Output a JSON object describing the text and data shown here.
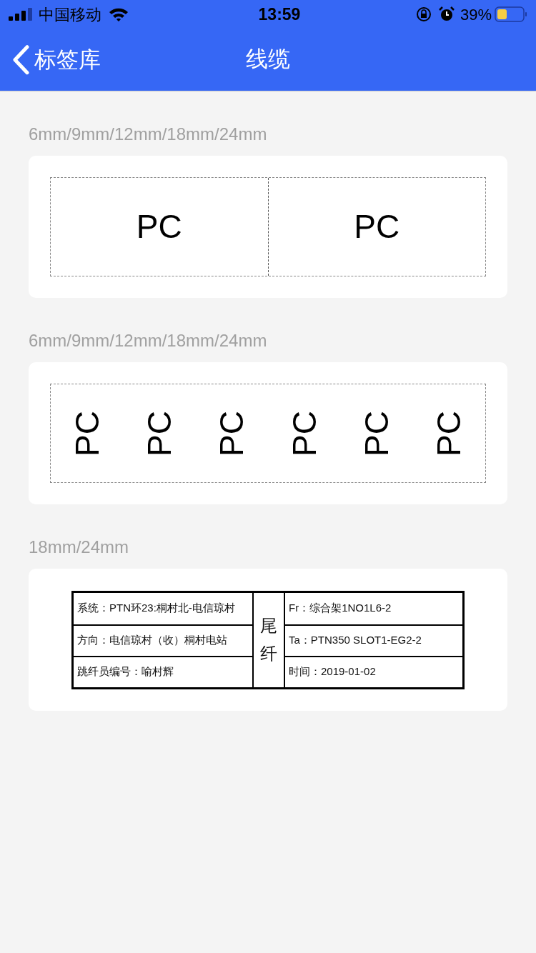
{
  "status_bar": {
    "carrier": "中国移动",
    "time": "13:59",
    "battery": "39%"
  },
  "nav": {
    "back": "标签库",
    "title": "线缆"
  },
  "sections": [
    {
      "label": "6mm/9mm/12mm/18mm/24mm",
      "kind": "horizontal",
      "items": [
        "PC",
        "PC"
      ]
    },
    {
      "label": "6mm/9mm/12mm/18mm/24mm",
      "kind": "vertical",
      "items": [
        "PC",
        "PC",
        "PC",
        "PC",
        "PC",
        "PC"
      ]
    },
    {
      "label": "18mm/24mm",
      "kind": "table",
      "left": [
        "系统：PTN环23:桐村北-电信琼村",
        "方向：电信琼村（收）桐村电站",
        "跳纤员编号：喻村辉"
      ],
      "middle": "尾纤",
      "right": [
        "Fr：综合架1NO1L6-2",
        "Ta：PTN350 SLOT1-EG2-2",
        "时间：2019-01-02"
      ]
    }
  ]
}
